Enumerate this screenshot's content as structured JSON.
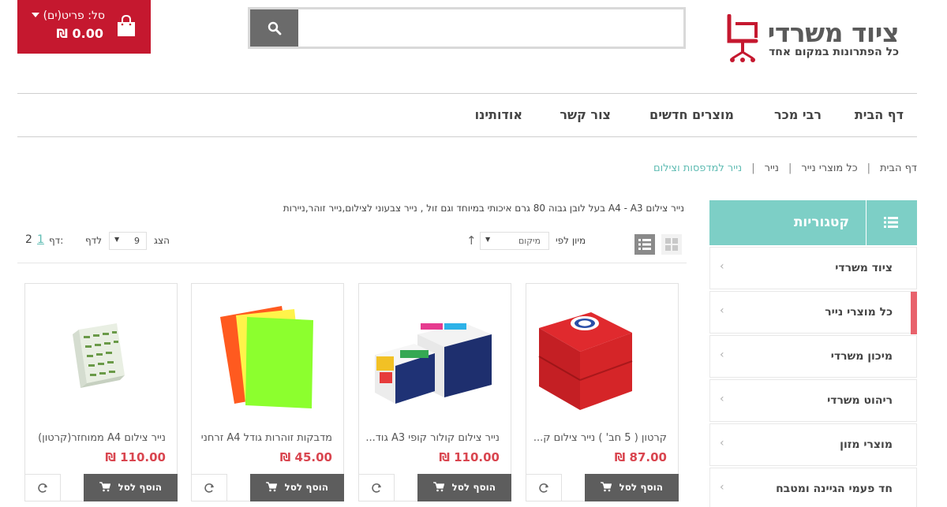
{
  "header": {
    "cart": {
      "label": "סל: פריט(ים)",
      "total": "0.00 ₪",
      "icon": "shopping-bag-icon"
    },
    "search": {
      "placeholder": "",
      "icon": "search-icon"
    },
    "logo": {
      "name": "ציוד משרדי",
      "tagline": "כל הפתרונות במקום אחד",
      "icon": "office-chair-icon",
      "colors": {
        "chair": "#c5182f",
        "text": "#5a5a5a"
      }
    }
  },
  "nav": {
    "home": "דף הבית",
    "bestsellers": "רבי מכר",
    "new_products": "מוצרים חדשים",
    "contact": "צור קשר",
    "about": "אודותינו"
  },
  "breadcrumb": {
    "home": "דף הבית",
    "all_paper": "כל מוצרי נייר",
    "paper": "נייר",
    "current": "נייר למדפסות וצילום"
  },
  "sidebar": {
    "title": "קטגוריות",
    "icon": "list-icon",
    "items": [
      {
        "label": "ציוד משרדי",
        "active": false
      },
      {
        "label": "כל מוצרי נייר",
        "active": true
      },
      {
        "label": "מיכון משרדי",
        "active": false
      },
      {
        "label": "ריהוט משרדי",
        "active": false
      },
      {
        "label": "מוצרי מזון",
        "active": false
      },
      {
        "label": "חד פעמי הגיינה ומטבח",
        "active": false
      }
    ]
  },
  "description": "נייר צילום A4 - A3 בעל לובן גבוה 80 גרם איכותי במיוחד וגם זול , נייר צבעוני לצילום,נייר זוהר,ניירות",
  "toolbar": {
    "sort_by_label": "מיון לפי",
    "sort_value": "מיקום",
    "show_label": "הצג",
    "per_page_value": "9",
    "per_page_label": "לדף",
    "page_label": "דף:",
    "pages": [
      "1",
      "2"
    ],
    "current_page": "1"
  },
  "products": [
    {
      "name": "קרטון ( 5 חב' ) נייר צילום ק...",
      "price": "87.00 ₪",
      "add_label": "הוסף לסל"
    },
    {
      "name": "נייר צילום קולור קופי A3 גוד...",
      "price": "110.00 ₪",
      "add_label": "הוסף לסל"
    },
    {
      "name": "מדבקות זוהרות גודל A4 זרחני",
      "price": "45.00 ₪",
      "add_label": "הוסף לסל"
    },
    {
      "name": "נייר צילום A4 ממוחזר(קרטון)",
      "price": "110.00 ₪",
      "add_label": "הוסף לסל"
    }
  ],
  "colors": {
    "brand_red": "#c5182f",
    "teal": "#7dcfc6",
    "price": "#d9454f",
    "button_gray": "#5d5d5d",
    "active_indicator": "#e8626c"
  }
}
